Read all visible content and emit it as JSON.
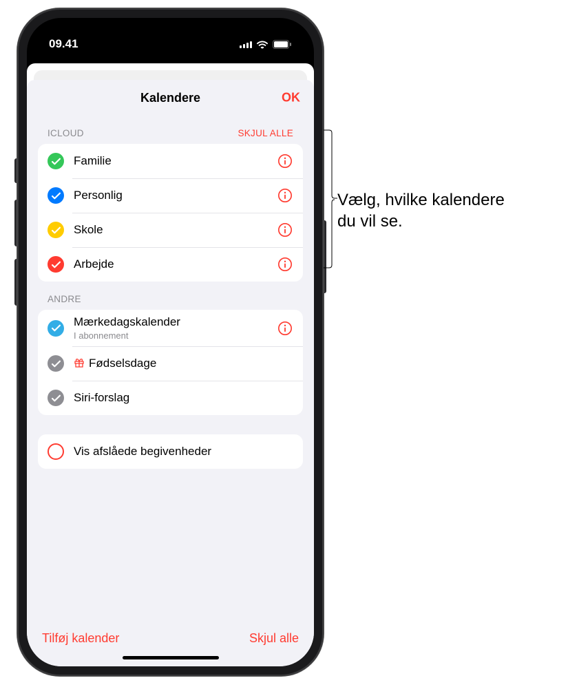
{
  "status": {
    "time": "09.41"
  },
  "sheet": {
    "title": "Kalendere",
    "ok": "OK"
  },
  "sections": {
    "icloud": {
      "header": "ICLOUD",
      "action": "SKJUL ALLE",
      "items": [
        {
          "label": "Familie"
        },
        {
          "label": "Personlig"
        },
        {
          "label": "Skole"
        },
        {
          "label": "Arbejde"
        }
      ]
    },
    "other": {
      "header": "ANDRE",
      "items": [
        {
          "label": "Mærkedagskalender",
          "sub": "I abonnement"
        },
        {
          "label": "Fødselsdage"
        },
        {
          "label": "Siri-forslag"
        }
      ]
    },
    "declined": {
      "label": "Vis afslåede begivenheder"
    }
  },
  "footer": {
    "add": "Tilføj kalender",
    "hideAll": "Skjul alle"
  },
  "callout": {
    "line1": "Vælg, hvilke kalendere",
    "line2": "du vil se."
  }
}
